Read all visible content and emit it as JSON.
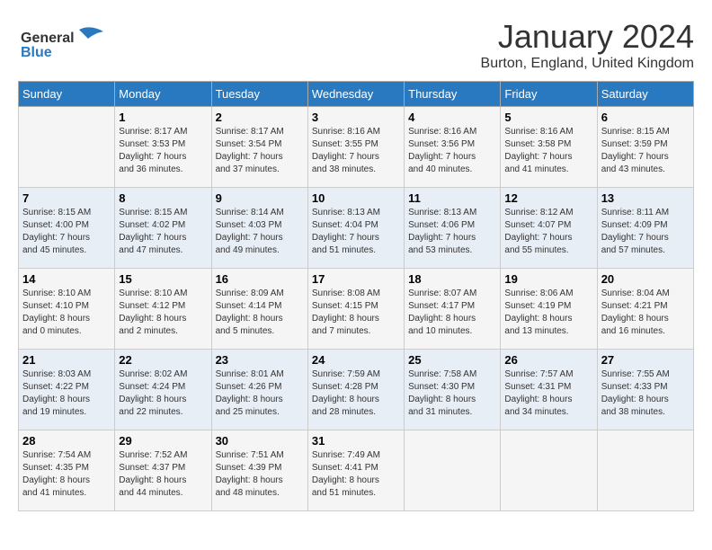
{
  "header": {
    "logo_line1": "General",
    "logo_line2": "Blue",
    "month": "January 2024",
    "location": "Burton, England, United Kingdom"
  },
  "days_of_week": [
    "Sunday",
    "Monday",
    "Tuesday",
    "Wednesday",
    "Thursday",
    "Friday",
    "Saturday"
  ],
  "weeks": [
    [
      {
        "day": "",
        "info": ""
      },
      {
        "day": "1",
        "info": "Sunrise: 8:17 AM\nSunset: 3:53 PM\nDaylight: 7 hours\nand 36 minutes."
      },
      {
        "day": "2",
        "info": "Sunrise: 8:17 AM\nSunset: 3:54 PM\nDaylight: 7 hours\nand 37 minutes."
      },
      {
        "day": "3",
        "info": "Sunrise: 8:16 AM\nSunset: 3:55 PM\nDaylight: 7 hours\nand 38 minutes."
      },
      {
        "day": "4",
        "info": "Sunrise: 8:16 AM\nSunset: 3:56 PM\nDaylight: 7 hours\nand 40 minutes."
      },
      {
        "day": "5",
        "info": "Sunrise: 8:16 AM\nSunset: 3:58 PM\nDaylight: 7 hours\nand 41 minutes."
      },
      {
        "day": "6",
        "info": "Sunrise: 8:15 AM\nSunset: 3:59 PM\nDaylight: 7 hours\nand 43 minutes."
      }
    ],
    [
      {
        "day": "7",
        "info": "Sunrise: 8:15 AM\nSunset: 4:00 PM\nDaylight: 7 hours\nand 45 minutes."
      },
      {
        "day": "8",
        "info": "Sunrise: 8:15 AM\nSunset: 4:02 PM\nDaylight: 7 hours\nand 47 minutes."
      },
      {
        "day": "9",
        "info": "Sunrise: 8:14 AM\nSunset: 4:03 PM\nDaylight: 7 hours\nand 49 minutes."
      },
      {
        "day": "10",
        "info": "Sunrise: 8:13 AM\nSunset: 4:04 PM\nDaylight: 7 hours\nand 51 minutes."
      },
      {
        "day": "11",
        "info": "Sunrise: 8:13 AM\nSunset: 4:06 PM\nDaylight: 7 hours\nand 53 minutes."
      },
      {
        "day": "12",
        "info": "Sunrise: 8:12 AM\nSunset: 4:07 PM\nDaylight: 7 hours\nand 55 minutes."
      },
      {
        "day": "13",
        "info": "Sunrise: 8:11 AM\nSunset: 4:09 PM\nDaylight: 7 hours\nand 57 minutes."
      }
    ],
    [
      {
        "day": "14",
        "info": "Sunrise: 8:10 AM\nSunset: 4:10 PM\nDaylight: 8 hours\nand 0 minutes."
      },
      {
        "day": "15",
        "info": "Sunrise: 8:10 AM\nSunset: 4:12 PM\nDaylight: 8 hours\nand 2 minutes."
      },
      {
        "day": "16",
        "info": "Sunrise: 8:09 AM\nSunset: 4:14 PM\nDaylight: 8 hours\nand 5 minutes."
      },
      {
        "day": "17",
        "info": "Sunrise: 8:08 AM\nSunset: 4:15 PM\nDaylight: 8 hours\nand 7 minutes."
      },
      {
        "day": "18",
        "info": "Sunrise: 8:07 AM\nSunset: 4:17 PM\nDaylight: 8 hours\nand 10 minutes."
      },
      {
        "day": "19",
        "info": "Sunrise: 8:06 AM\nSunset: 4:19 PM\nDaylight: 8 hours\nand 13 minutes."
      },
      {
        "day": "20",
        "info": "Sunrise: 8:04 AM\nSunset: 4:21 PM\nDaylight: 8 hours\nand 16 minutes."
      }
    ],
    [
      {
        "day": "21",
        "info": "Sunrise: 8:03 AM\nSunset: 4:22 PM\nDaylight: 8 hours\nand 19 minutes."
      },
      {
        "day": "22",
        "info": "Sunrise: 8:02 AM\nSunset: 4:24 PM\nDaylight: 8 hours\nand 22 minutes."
      },
      {
        "day": "23",
        "info": "Sunrise: 8:01 AM\nSunset: 4:26 PM\nDaylight: 8 hours\nand 25 minutes."
      },
      {
        "day": "24",
        "info": "Sunrise: 7:59 AM\nSunset: 4:28 PM\nDaylight: 8 hours\nand 28 minutes."
      },
      {
        "day": "25",
        "info": "Sunrise: 7:58 AM\nSunset: 4:30 PM\nDaylight: 8 hours\nand 31 minutes."
      },
      {
        "day": "26",
        "info": "Sunrise: 7:57 AM\nSunset: 4:31 PM\nDaylight: 8 hours\nand 34 minutes."
      },
      {
        "day": "27",
        "info": "Sunrise: 7:55 AM\nSunset: 4:33 PM\nDaylight: 8 hours\nand 38 minutes."
      }
    ],
    [
      {
        "day": "28",
        "info": "Sunrise: 7:54 AM\nSunset: 4:35 PM\nDaylight: 8 hours\nand 41 minutes."
      },
      {
        "day": "29",
        "info": "Sunrise: 7:52 AM\nSunset: 4:37 PM\nDaylight: 8 hours\nand 44 minutes."
      },
      {
        "day": "30",
        "info": "Sunrise: 7:51 AM\nSunset: 4:39 PM\nDaylight: 8 hours\nand 48 minutes."
      },
      {
        "day": "31",
        "info": "Sunrise: 7:49 AM\nSunset: 4:41 PM\nDaylight: 8 hours\nand 51 minutes."
      },
      {
        "day": "",
        "info": ""
      },
      {
        "day": "",
        "info": ""
      },
      {
        "day": "",
        "info": ""
      }
    ]
  ]
}
